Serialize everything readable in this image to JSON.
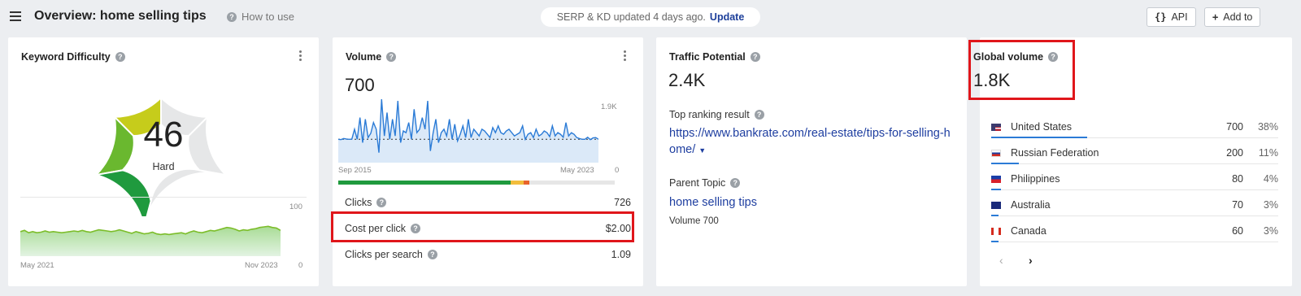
{
  "header": {
    "title": "Overview: home selling tips",
    "how_to_use": "How to use",
    "status_text": "SERP & KD updated 4 days ago.",
    "update_label": "Update",
    "api_label": "API",
    "add_to_label": "Add to"
  },
  "kd": {
    "title": "Keyword Difficulty",
    "value": "46",
    "label": "Hard",
    "trend_max": "100",
    "trend_min": "0",
    "trend_start": "May 2021",
    "trend_end": "Nov 2023",
    "trend_values": [
      42,
      44,
      40,
      42,
      40,
      41,
      43,
      41,
      42,
      41,
      40,
      41,
      42,
      43,
      42,
      44,
      42,
      41,
      43,
      45,
      44,
      43,
      42,
      43,
      45,
      43,
      41,
      39,
      42,
      40,
      38,
      39,
      41,
      38,
      37,
      38,
      37,
      38,
      39,
      40,
      38,
      41,
      43,
      41,
      40,
      42,
      44,
      43,
      45,
      47,
      49,
      48,
      46,
      43,
      45,
      44,
      46,
      47,
      49,
      50,
      51,
      49,
      48,
      44
    ]
  },
  "volume": {
    "title": "Volume",
    "value": "700",
    "chart_max": "1.9K",
    "chart_min": "0",
    "chart_start": "Sep 2015",
    "chart_end": "May 2023",
    "chart_values": [
      700,
      690,
      720,
      710,
      700,
      705,
      1000,
      700,
      1350,
      600,
      1300,
      750,
      880,
      1200,
      1000,
      300,
      1900,
      800,
      1500,
      700,
      1300,
      800,
      1850,
      600,
      950,
      900,
      1200,
      700,
      1600,
      900,
      1000,
      1350,
      1000,
      1850,
      350,
      900,
      1300,
      600,
      900,
      1000,
      800,
      1300,
      700,
      1150,
      650,
      850,
      1100,
      750,
      1300,
      750,
      1000,
      900,
      800,
      1000,
      950,
      850,
      750,
      1050,
      900,
      1100,
      900,
      850,
      950,
      1000,
      900,
      800,
      850,
      900,
      1100,
      700,
      850,
      900,
      750,
      1000,
      800,
      850,
      950,
      900,
      780,
      1100,
      800,
      900,
      850,
      760,
      1200,
      800,
      900,
      850,
      750,
      720,
      700,
      700,
      760,
      690,
      740,
      750,
      700
    ],
    "clicks_label": "Clicks",
    "clicks_value": "726",
    "cpc_label": "Cost per click",
    "cpc_value": "$2.00",
    "cps_label": "Clicks per search",
    "cps_value": "1.09"
  },
  "traffic": {
    "title": "Traffic Potential",
    "value": "2.4K",
    "top_result_label": "Top ranking result",
    "top_result_url": "https://www.bankrate.com/real-estate/tips-for-selling-home/",
    "parent_topic_label": "Parent Topic",
    "parent_topic": "home selling tips",
    "parent_volume": "Volume 700"
  },
  "global": {
    "title": "Global volume",
    "value": "1.8K",
    "countries": [
      {
        "name": "United States",
        "volume": "700",
        "pct": "38%",
        "share": 0.38,
        "flag": "us"
      },
      {
        "name": "Russian Federation",
        "volume": "200",
        "pct": "11%",
        "share": 0.11,
        "flag": "ru"
      },
      {
        "name": "Philippines",
        "volume": "80",
        "pct": "4%",
        "share": 0.04,
        "flag": "ph"
      },
      {
        "name": "Australia",
        "volume": "70",
        "pct": "3%",
        "share": 0.03,
        "flag": "au"
      },
      {
        "name": "Canada",
        "volume": "60",
        "pct": "3%",
        "share": 0.03,
        "flag": "ca"
      }
    ]
  },
  "colors": {
    "accent": "#1e3ea0",
    "highlight": "#e0161b",
    "kd_green_dark": "#1f9a3e",
    "kd_green": "#6ab82f",
    "kd_yellow": "#c6cc1b",
    "line_blue": "#2b7bd6"
  }
}
